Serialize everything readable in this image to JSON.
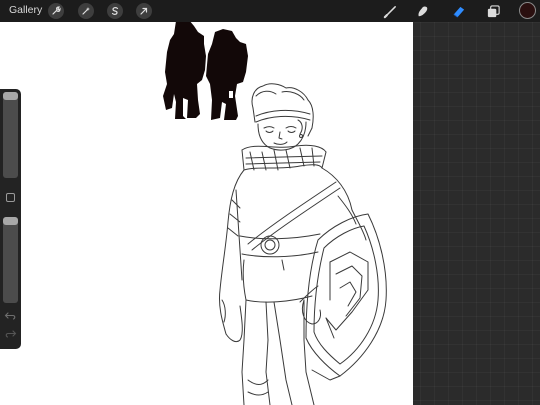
{
  "topbar": {
    "gallery_label": "Gallery",
    "left_tools": [
      {
        "name": "actions",
        "icon": "wrench-icon"
      },
      {
        "name": "adjustments",
        "icon": "magic-wand-icon"
      },
      {
        "name": "selection",
        "icon": "selection-s-icon"
      },
      {
        "name": "transform",
        "icon": "arrow-cursor-icon"
      }
    ],
    "right_tools": [
      {
        "name": "brush",
        "icon": "brush-icon",
        "active": false
      },
      {
        "name": "smudge",
        "icon": "smudge-finger-icon",
        "active": false
      },
      {
        "name": "eraser",
        "icon": "eraser-icon",
        "active": true
      },
      {
        "name": "layers",
        "icon": "layers-icon",
        "active": false
      }
    ],
    "current_color": "#2a0f0f"
  },
  "sidebar": {
    "brush_size_level": 1.0,
    "opacity_level": 1.0,
    "modify_icon": "square-icon",
    "undo_icon": "undo-arrow-icon",
    "redo_icon": "redo-arrow-icon"
  },
  "colors": {
    "accent_active_tool": "#2f8cff",
    "toolbar_bg": "#1c1c1c",
    "workspace_bg": "#2b2b2b",
    "canvas_bg": "#ffffff"
  }
}
